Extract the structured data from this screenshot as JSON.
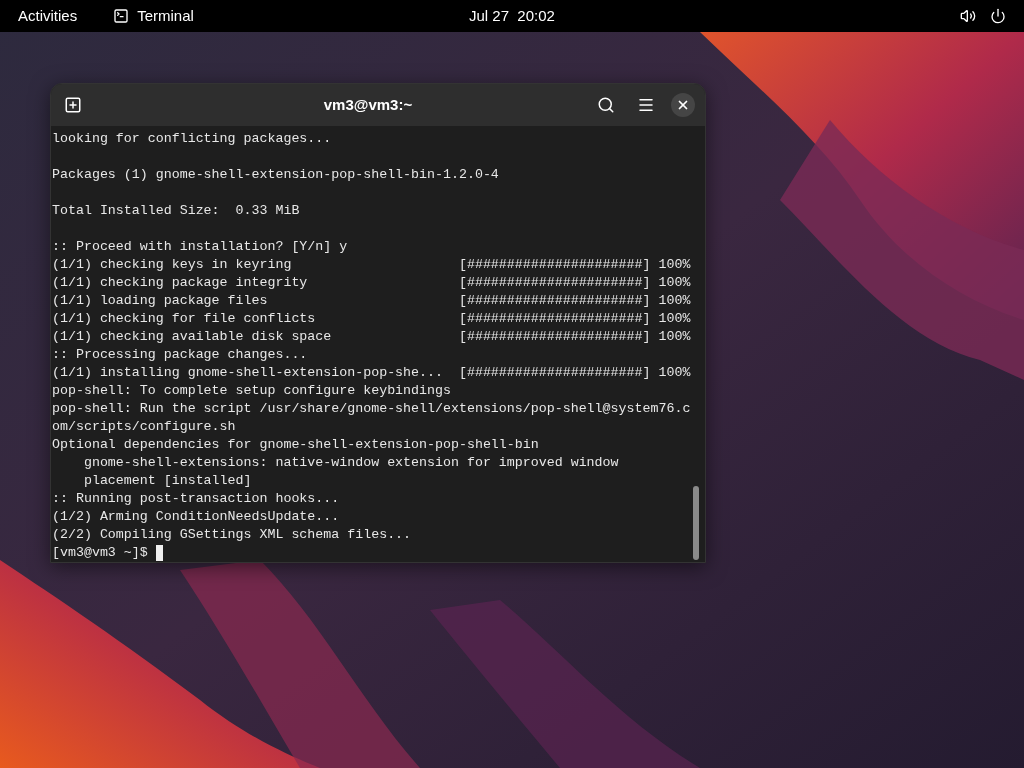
{
  "top_bar": {
    "activities": "Activities",
    "app": "Terminal",
    "clock": "Jul 27  20:02"
  },
  "window": {
    "title": "vm3@vm3:~"
  },
  "terminal": {
    "lines": [
      {
        "kind": "text",
        "text": "looking for conflicting packages..."
      },
      {
        "kind": "blank"
      },
      {
        "kind": "text",
        "text": "Packages (1) gnome-shell-extension-pop-shell-bin-1.2.0-4"
      },
      {
        "kind": "blank"
      },
      {
        "kind": "text",
        "text": "Total Installed Size:  0.33 MiB"
      },
      {
        "kind": "blank"
      },
      {
        "kind": "text",
        "text": ":: Proceed with installation? [Y/n] y"
      },
      {
        "kind": "text",
        "text": "(1/1) checking keys in keyring                     [######################] 100%"
      },
      {
        "kind": "text",
        "text": "(1/1) checking package integrity                   [######################] 100%"
      },
      {
        "kind": "text",
        "text": "(1/1) loading package files                        [######################] 100%"
      },
      {
        "kind": "text",
        "text": "(1/1) checking for file conflicts                  [######################] 100%"
      },
      {
        "kind": "text",
        "text": "(1/1) checking available disk space                [######################] 100%"
      },
      {
        "kind": "text",
        "text": ":: Processing package changes..."
      },
      {
        "kind": "text",
        "text": "(1/1) installing gnome-shell-extension-pop-she...  [######################] 100%"
      },
      {
        "kind": "text",
        "text": "pop-shell: To complete setup configure keybindings"
      },
      {
        "kind": "text",
        "text": "pop-shell: Run the script /usr/share/gnome-shell/extensions/pop-shell@system76.c"
      },
      {
        "kind": "text",
        "text": "om/scripts/configure.sh"
      },
      {
        "kind": "text",
        "text": "Optional dependencies for gnome-shell-extension-pop-shell-bin"
      },
      {
        "kind": "text",
        "text": "    gnome-shell-extensions: native-window extension for improved window"
      },
      {
        "kind": "text",
        "text": "    placement [installed]"
      },
      {
        "kind": "text",
        "text": ":: Running post-transaction hooks..."
      },
      {
        "kind": "text",
        "text": "(1/2) Arming ConditionNeedsUpdate..."
      },
      {
        "kind": "text",
        "text": "(2/2) Compiling GSettings XML schema files..."
      },
      {
        "kind": "prompt",
        "text": "[vm3@vm3 ~]$"
      }
    ]
  }
}
